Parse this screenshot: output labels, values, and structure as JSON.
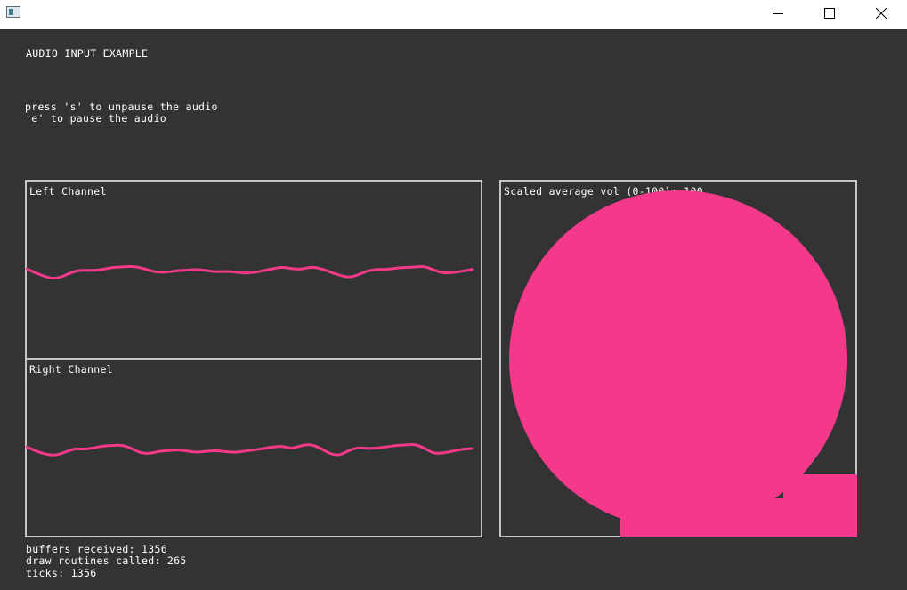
{
  "window": {
    "minimize_icon": "minimize-icon",
    "maximize_icon": "maximize-icon",
    "close_icon": "close-icon"
  },
  "header": {
    "title": "AUDIO INPUT EXAMPLE",
    "instruction_1": "press 's' to unpause the audio",
    "instruction_2": "'e' to pause the audio"
  },
  "left_panel": {
    "label": "Left Channel"
  },
  "right_panel": {
    "label": "Right Channel"
  },
  "volume_panel": {
    "label": "Scaled average vol (0-100): 100"
  },
  "stats": {
    "buffers": "buffers received: 1356",
    "draws": "draw routines called: 265",
    "ticks": "ticks: 1356"
  },
  "colors": {
    "background": "#333333",
    "accent": "#f5398a",
    "panel_border": "#c4c4c4",
    "text": "#ffffff"
  },
  "chart_data": {
    "type": "line",
    "series": [
      {
        "name": "Left Channel",
        "values": [
          0.0,
          -0.35,
          -0.65,
          -0.8,
          -0.55,
          -0.2,
          -0.1,
          -0.15,
          -0.05,
          0.1,
          0.15,
          0.2,
          0.1,
          -0.15,
          -0.3,
          -0.25,
          -0.15,
          -0.1,
          -0.05,
          -0.15,
          -0.25,
          -0.2,
          -0.25,
          -0.35,
          -0.3,
          -0.15,
          0.0,
          0.15,
          0.0,
          -0.05,
          0.15,
          0.05,
          -0.25,
          -0.5,
          -0.7,
          -0.5,
          -0.15,
          -0.05,
          -0.05,
          0.05,
          0.1,
          0.15,
          0.2,
          -0.1,
          -0.35,
          -0.3,
          -0.2,
          -0.05
        ]
      },
      {
        "name": "Right Channel",
        "values": [
          0.0,
          -0.35,
          -0.6,
          -0.7,
          -0.45,
          -0.15,
          -0.2,
          -0.1,
          0.05,
          0.1,
          0.15,
          -0.1,
          -0.5,
          -0.55,
          -0.35,
          -0.3,
          -0.25,
          -0.35,
          -0.45,
          -0.35,
          -0.3,
          -0.4,
          -0.45,
          -0.35,
          -0.25,
          -0.15,
          0.0,
          0.05,
          -0.15,
          0.1,
          0.2,
          -0.1,
          -0.55,
          -0.7,
          -0.3,
          -0.05,
          -0.15,
          -0.1,
          0.0,
          0.1,
          0.15,
          0.2,
          -0.1,
          -0.55,
          -0.5,
          -0.35,
          -0.2,
          -0.15
        ]
      }
    ],
    "volume": 100
  }
}
